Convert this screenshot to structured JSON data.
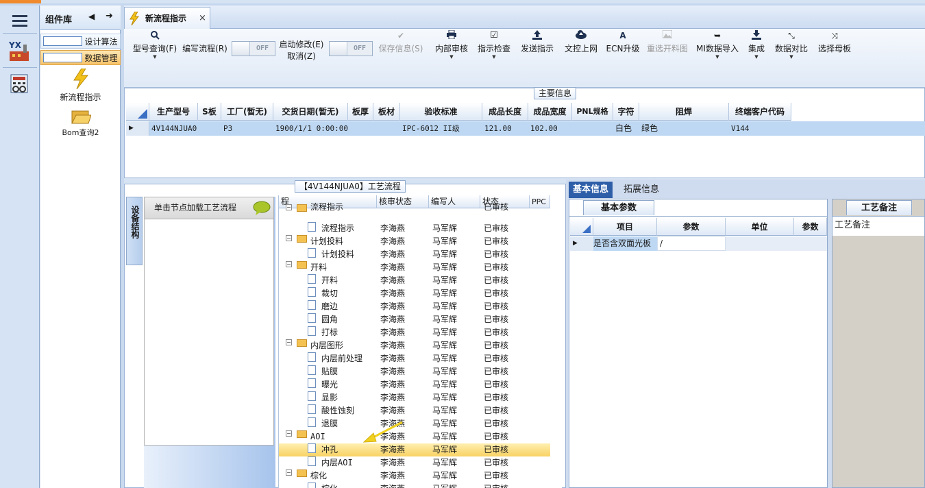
{
  "component_panel": {
    "title": "组件库",
    "items": [
      {
        "label": "设计算法",
        "selected": false
      },
      {
        "label": "数据管理",
        "selected": true
      }
    ],
    "icons": [
      {
        "label": "新流程指示"
      },
      {
        "label": "Bom查询2"
      }
    ]
  },
  "rail": {
    "logo_text": "YX"
  },
  "tabs": [
    {
      "label": "新流程指示",
      "close": "×"
    }
  ],
  "toolbar": {
    "items": [
      {
        "label": "型号查询(F)",
        "icon": "search-icon",
        "dropdown": true,
        "disabled": false
      },
      {
        "label": "编写流程(R)",
        "icon": "",
        "dropdown": false,
        "disabled": false
      },
      {
        "label": "启动修改(E)",
        "label2": "取消(Z)",
        "disabled": false
      },
      {
        "label": "保存信息(S)",
        "icon": "check-icon",
        "disabled": true
      },
      {
        "label": "内部审核",
        "icon": "printer-icon",
        "dropdown": true,
        "disabled": false
      },
      {
        "label": "指示检查",
        "icon": "checkbox-icon",
        "dropdown": true,
        "disabled": false
      },
      {
        "label": "发送指示",
        "icon": "upload-icon",
        "disabled": false
      },
      {
        "label": "文控上网",
        "icon": "cloud-upload-icon",
        "disabled": false
      },
      {
        "label": "ECN升级",
        "icon": "ecn-icon",
        "disabled": false
      },
      {
        "label": "重选开料图",
        "icon": "image-icon",
        "disabled": true
      },
      {
        "label": "MI数据导入",
        "icon": "import-icon",
        "dropdown": true,
        "disabled": false
      },
      {
        "label": "集成",
        "icon": "download-icon",
        "dropdown": true,
        "disabled": false
      },
      {
        "label": "数据对比",
        "icon": "compare-icon",
        "dropdown": true,
        "disabled": false
      },
      {
        "label": "选择母板",
        "icon": "shuffle-icon",
        "disabled": false
      }
    ],
    "toggle1": "OFF",
    "toggle2": "OFF"
  },
  "main_info": {
    "title": "主要信息",
    "columns": [
      "生产型号",
      "S板",
      "工厂(暂无)",
      "交货日期(暂无)",
      "板厚",
      "板材",
      "验收标准",
      "成品长度",
      "成品宽度",
      "PNL规格",
      "字符",
      "阻焊",
      "终端客户代码"
    ],
    "row": [
      "4V144NJUA0",
      "",
      "P3",
      "1900/1/1 0:00:00",
      "",
      "",
      "IPC-6012 II级",
      "121.00",
      "102.00",
      "",
      "白色",
      "绿色",
      "V144"
    ]
  },
  "process": {
    "title": "【4V144NJUA0】工艺流程",
    "side_tab": "设备结构",
    "node_hint": "单击节点加载工艺流程",
    "columns": [
      "程",
      "核审状态",
      "编写人",
      "状态",
      "PPC"
    ],
    "rows": [
      {
        "name": "流程指示",
        "level": 0,
        "type": "folder",
        "reviewer": "",
        "writer": "",
        "status": "已审核",
        "partial": true
      },
      {
        "name": "流程指示",
        "level": 1,
        "type": "doc",
        "reviewer": "李海燕",
        "writer": "马军辉",
        "status": "已审核"
      },
      {
        "name": "计划投料",
        "level": 0,
        "type": "folder",
        "reviewer": "李海燕",
        "writer": "马军辉",
        "status": "已审核"
      },
      {
        "name": "计划投料",
        "level": 1,
        "type": "doc",
        "reviewer": "李海燕",
        "writer": "马军辉",
        "status": "已审核"
      },
      {
        "name": "开料",
        "level": 0,
        "type": "folder",
        "reviewer": "李海燕",
        "writer": "马军辉",
        "status": "已审核"
      },
      {
        "name": "开料",
        "level": 1,
        "type": "doc",
        "reviewer": "李海燕",
        "writer": "马军辉",
        "status": "已审核"
      },
      {
        "name": "裁切",
        "level": 1,
        "type": "doc",
        "reviewer": "李海燕",
        "writer": "马军辉",
        "status": "已审核"
      },
      {
        "name": "磨边",
        "level": 1,
        "type": "doc",
        "reviewer": "李海燕",
        "writer": "马军辉",
        "status": "已审核"
      },
      {
        "name": "圆角",
        "level": 1,
        "type": "doc",
        "reviewer": "李海燕",
        "writer": "马军辉",
        "status": "已审核"
      },
      {
        "name": "打标",
        "level": 1,
        "type": "doc",
        "reviewer": "李海燕",
        "writer": "马军辉",
        "status": "已审核"
      },
      {
        "name": "内层图形",
        "level": 0,
        "type": "folder",
        "reviewer": "李海燕",
        "writer": "马军辉",
        "status": "已审核"
      },
      {
        "name": "内层前处理",
        "level": 1,
        "type": "doc",
        "reviewer": "李海燕",
        "writer": "马军辉",
        "status": "已审核"
      },
      {
        "name": "贴膜",
        "level": 1,
        "type": "doc",
        "reviewer": "李海燕",
        "writer": "马军辉",
        "status": "已审核"
      },
      {
        "name": "曝光",
        "level": 1,
        "type": "doc",
        "reviewer": "李海燕",
        "writer": "马军辉",
        "status": "已审核"
      },
      {
        "name": "显影",
        "level": 1,
        "type": "doc",
        "reviewer": "李海燕",
        "writer": "马军辉",
        "status": "已审核"
      },
      {
        "name": "酸性蚀刻",
        "level": 1,
        "type": "doc",
        "reviewer": "李海燕",
        "writer": "马军辉",
        "status": "已审核"
      },
      {
        "name": "退膜",
        "level": 1,
        "type": "doc",
        "reviewer": "李海燕",
        "writer": "马军辉",
        "status": "已审核"
      },
      {
        "name": "AOI",
        "level": 0,
        "type": "folder",
        "reviewer": "李海燕",
        "writer": "马军辉",
        "status": "已审核"
      },
      {
        "name": "冲孔",
        "level": 1,
        "type": "doc",
        "reviewer": "李海燕",
        "writer": "马军辉",
        "status": "已审核",
        "selected": true
      },
      {
        "name": "内层AOI",
        "level": 1,
        "type": "doc",
        "reviewer": "李海燕",
        "writer": "马军辉",
        "status": "已审核"
      },
      {
        "name": "棕化",
        "level": 0,
        "type": "folder",
        "reviewer": "李海燕",
        "writer": "马军辉",
        "status": "已审核"
      },
      {
        "name": "棕化",
        "level": 1,
        "type": "doc",
        "reviewer": "李海燕",
        "writer": "马军辉",
        "status": "已审核"
      }
    ]
  },
  "right": {
    "tabs": [
      "基本信息",
      "拓展信息"
    ],
    "basic_tab": "基本参数",
    "remark_tab": "工艺备注",
    "remark_label": "工艺备注",
    "columns": [
      "项目",
      "参数",
      "单位",
      "参数"
    ],
    "row": [
      "是否含双面光板",
      "/",
      "",
      ""
    ]
  }
}
